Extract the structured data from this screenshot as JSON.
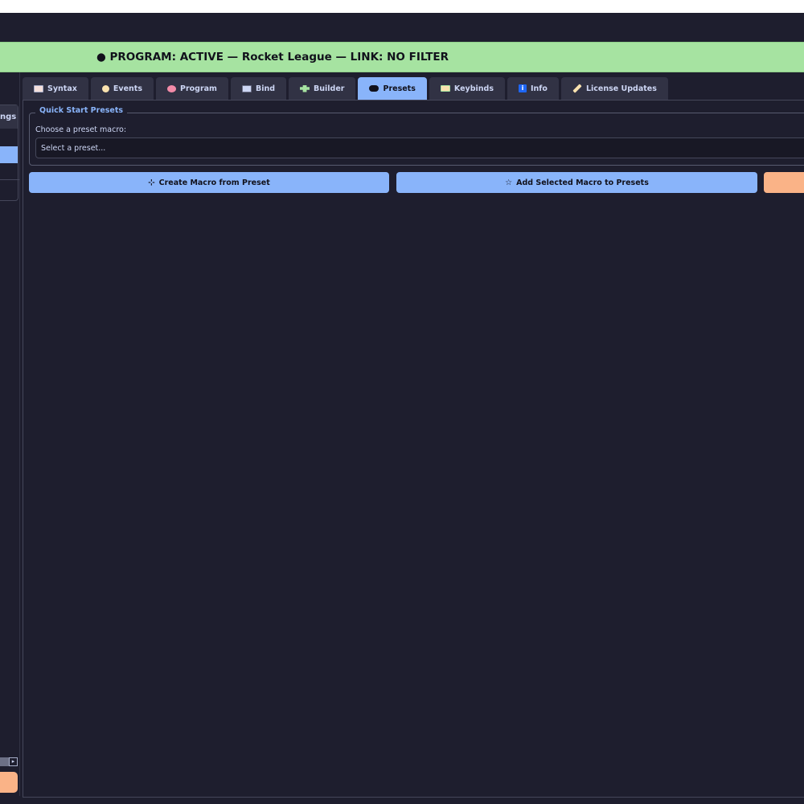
{
  "status": {
    "text": "● PROGRAM: ACTIVE — Rocket League — LINK: NO FILTER",
    "color": "#a6e3a1"
  },
  "sidebar": {
    "tab_label": "ngs"
  },
  "tabs": [
    {
      "label": "Syntax",
      "icon": "memo-icon"
    },
    {
      "label": "Events",
      "icon": "stopwatch-icon"
    },
    {
      "label": "Program",
      "icon": "brain-icon"
    },
    {
      "label": "Bind",
      "icon": "keyboard-icon"
    },
    {
      "label": "Builder",
      "icon": "puzzle-icon"
    },
    {
      "label": "Presets",
      "icon": "gamepad-icon",
      "active": true
    },
    {
      "label": "Keybinds",
      "icon": "list-icon"
    },
    {
      "label": "Info",
      "icon": "info-icon"
    },
    {
      "label": "License  Updates",
      "icon": "wrench-icon"
    }
  ],
  "presets": {
    "group_title": "Quick Start Presets",
    "choose_label": "Choose a preset macro:",
    "select_value": "Select a preset...",
    "create_button": "Create Macro from Preset",
    "add_button": "Add Selected Macro to Presets"
  },
  "colors": {
    "background": "#1e1e2e",
    "accent": "#89b4fa",
    "orange": "#fab387",
    "tab": "#313244"
  }
}
